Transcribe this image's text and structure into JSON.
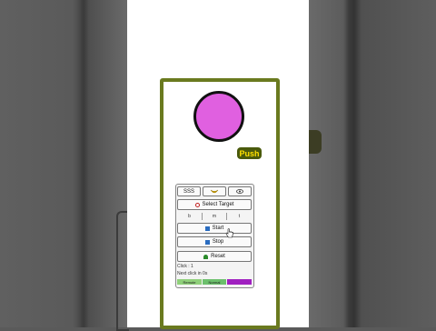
{
  "app": {
    "push_label": "Push"
  },
  "toolbar": {
    "sss_label": "SSS",
    "banana_icon": "banana-icon",
    "eye_icon": "eye-icon"
  },
  "panel": {
    "select_target_label": "Select Target",
    "segments": [
      "b",
      "m",
      "t"
    ],
    "start_label": "Start",
    "stop_label": "Stop",
    "reset_label": "Reset",
    "click_text": "Click : 1",
    "next_click_text": "Next click in 0s"
  },
  "bottom_bar": [
    {
      "label": "Remote",
      "color": "#8fd07a"
    },
    {
      "label": "Normal",
      "color": "#6cc06c"
    },
    {
      "label": "",
      "color": "#a020c0"
    }
  ],
  "colors": {
    "frame": "#6a7a1f",
    "ball": "#e060e0",
    "push_bg": "#4a5a0c",
    "push_text": "#ffe000"
  }
}
